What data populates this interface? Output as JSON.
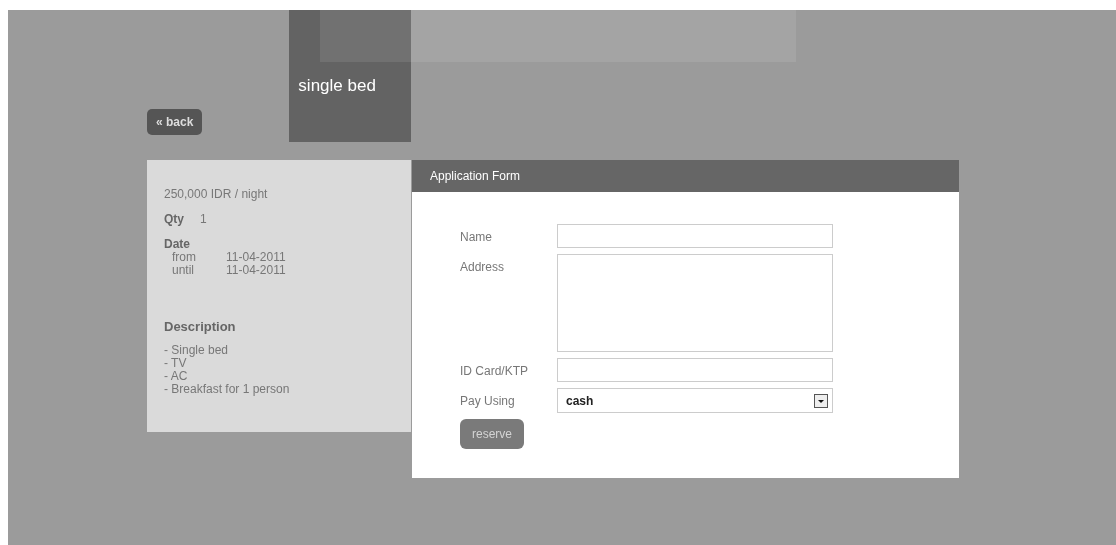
{
  "room": {
    "title": "single bed"
  },
  "back_button": {
    "label": "« back"
  },
  "details": {
    "price": "250,000 IDR / night",
    "qty_label": "Qty",
    "qty": "1",
    "date_label": "Date",
    "dates": [
      {
        "label": "from",
        "value": "11-04-2011"
      },
      {
        "label": "until",
        "value": "11-04-2011"
      }
    ],
    "description_title": "Description",
    "description_items": [
      "- Single bed",
      "- TV",
      "- AC",
      "- Breakfast for 1 person"
    ]
  },
  "form": {
    "title": "Application Form",
    "fields": [
      {
        "kind": "text",
        "label": "Name"
      },
      {
        "kind": "textarea",
        "label": "Address"
      },
      {
        "kind": "text",
        "label": "ID Card/KTP"
      },
      {
        "kind": "select",
        "label": "Pay Using",
        "value": "cash"
      }
    ],
    "submit": {
      "label": "reserve",
      "disabled": true
    }
  }
}
